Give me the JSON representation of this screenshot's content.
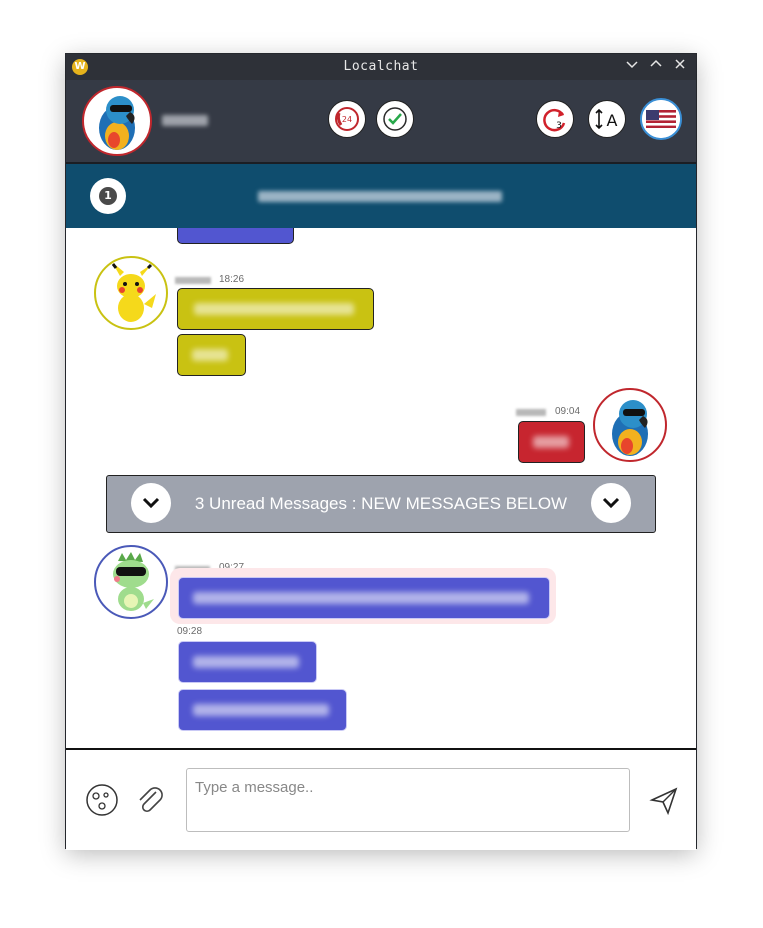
{
  "window": {
    "title": "Localchat",
    "controls": [
      "minimize",
      "maximize",
      "close"
    ]
  },
  "header": {
    "user_avatar": "parrot-avatar",
    "toolbar_icons": [
      "phone-24-icon",
      "checkmark-icon",
      "refresh-3-icon",
      "text-size-icon",
      "us-flag-icon"
    ],
    "refresh_count": "3"
  },
  "banner": {
    "badge_count": "1"
  },
  "messages": [
    {
      "sender": "pikachu",
      "time": "18:26",
      "side": "left"
    },
    {
      "sender": "parrot",
      "time": "09:04",
      "side": "right"
    },
    {
      "sender": "dino",
      "time": "09:27",
      "side": "left"
    },
    {
      "sender": "dino",
      "time": "09:28",
      "side": "left"
    }
  ],
  "unread": {
    "text": "3 Unread Messages : NEW MESSAGES BELOW"
  },
  "composer": {
    "placeholder": "Type a message..",
    "value": ""
  },
  "colors": {
    "header_bg": "#353a45",
    "banner_bg": "#0f4d6e",
    "bubble_blue": "#5256d0",
    "bubble_yellow": "#c9c212",
    "bubble_red": "#c7252f",
    "unread_bg": "#9ea3ae"
  }
}
